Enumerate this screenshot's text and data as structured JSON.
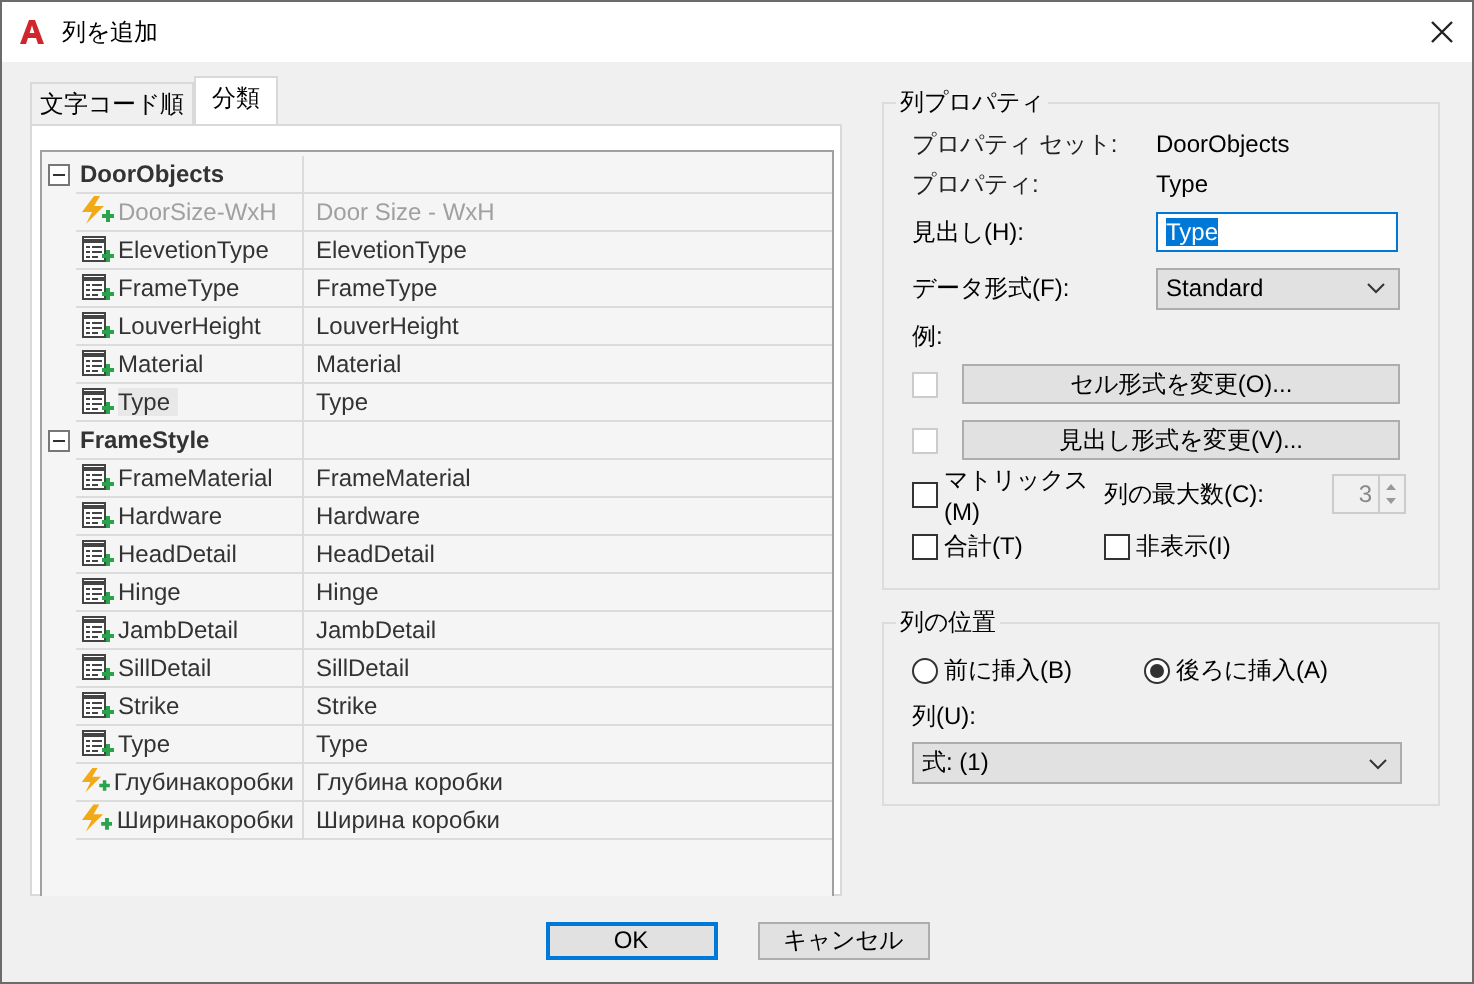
{
  "window": {
    "title": "列を追加"
  },
  "tabs": [
    {
      "label": "文字コード順",
      "selected": false
    },
    {
      "label": "分類",
      "selected": true
    }
  ],
  "tree": [
    {
      "name": "DoorObjects",
      "expanded": true,
      "children": [
        {
          "kind": "formula",
          "name": "DoorSize-WxH",
          "heading": "Door Size - WxH",
          "disabled": true,
          "selected": false
        },
        {
          "kind": "property",
          "name": "ElevetionType",
          "heading": "ElevetionType",
          "disabled": false,
          "selected": false
        },
        {
          "kind": "property",
          "name": "FrameType",
          "heading": "FrameType",
          "disabled": false,
          "selected": false
        },
        {
          "kind": "property",
          "name": "LouverHeight",
          "heading": "LouverHeight",
          "disabled": false,
          "selected": false
        },
        {
          "kind": "property",
          "name": "Material",
          "heading": "Material",
          "disabled": false,
          "selected": false
        },
        {
          "kind": "property",
          "name": "Type",
          "heading": "Type",
          "disabled": false,
          "selected": true
        }
      ]
    },
    {
      "name": "FrameStyle",
      "expanded": true,
      "children": [
        {
          "kind": "property",
          "name": "FrameMaterial",
          "heading": "FrameMaterial",
          "disabled": false,
          "selected": false
        },
        {
          "kind": "property",
          "name": "Hardware",
          "heading": "Hardware",
          "disabled": false,
          "selected": false
        },
        {
          "kind": "property",
          "name": "HeadDetail",
          "heading": "HeadDetail",
          "disabled": false,
          "selected": false
        },
        {
          "kind": "property",
          "name": "Hinge",
          "heading": "Hinge",
          "disabled": false,
          "selected": false
        },
        {
          "kind": "property",
          "name": "JambDetail",
          "heading": "JambDetail",
          "disabled": false,
          "selected": false
        },
        {
          "kind": "property",
          "name": "SillDetail",
          "heading": "SillDetail",
          "disabled": false,
          "selected": false
        },
        {
          "kind": "property",
          "name": "Strike",
          "heading": "Strike",
          "disabled": false,
          "selected": false
        },
        {
          "kind": "property",
          "name": "Type",
          "heading": "Type",
          "disabled": false,
          "selected": false
        },
        {
          "kind": "formula",
          "name": "Глубинакоробки",
          "heading": "Глубина коробки",
          "disabled": false,
          "selected": false
        },
        {
          "kind": "formula",
          "name": "Ширинакоробки",
          "heading": "Ширина коробки",
          "disabled": false,
          "selected": false
        }
      ]
    }
  ],
  "column_properties": {
    "title": "列プロパティ",
    "property_set": {
      "label": "プロパティ セット:",
      "value": "DoorObjects"
    },
    "property": {
      "label": "プロパティ:",
      "value": "Type"
    },
    "heading": {
      "label": "見出し(H):",
      "value": "Type"
    },
    "data_format": {
      "label": "データ形式(F):",
      "value": "Standard"
    },
    "example": {
      "label": "例:"
    },
    "format_buttons": [
      {
        "label": "セル形式を変更(O)...",
        "checked": false,
        "disabled": true
      },
      {
        "label": "見出し形式を変更(V)...",
        "checked": false,
        "disabled": true
      }
    ],
    "matrix": {
      "label": "マトリックス(M)",
      "checked": false
    },
    "max_columns": {
      "label": "列の最大数(C):",
      "value": "3",
      "disabled": true
    },
    "total": {
      "label": "合計(T)",
      "checked": false
    },
    "hidden": {
      "label": "非表示(I)",
      "checked": false
    }
  },
  "column_position": {
    "title": "列の位置",
    "options": [
      {
        "label": "前に挿入(B)",
        "selected": false
      },
      {
        "label": "後ろに挿入(A)",
        "selected": true
      }
    ],
    "column": {
      "label": "列(U):",
      "value": "式: (1)"
    }
  },
  "buttons": [
    {
      "label": "OK",
      "default": true
    },
    {
      "label": "キャンセル",
      "default": false
    }
  ]
}
